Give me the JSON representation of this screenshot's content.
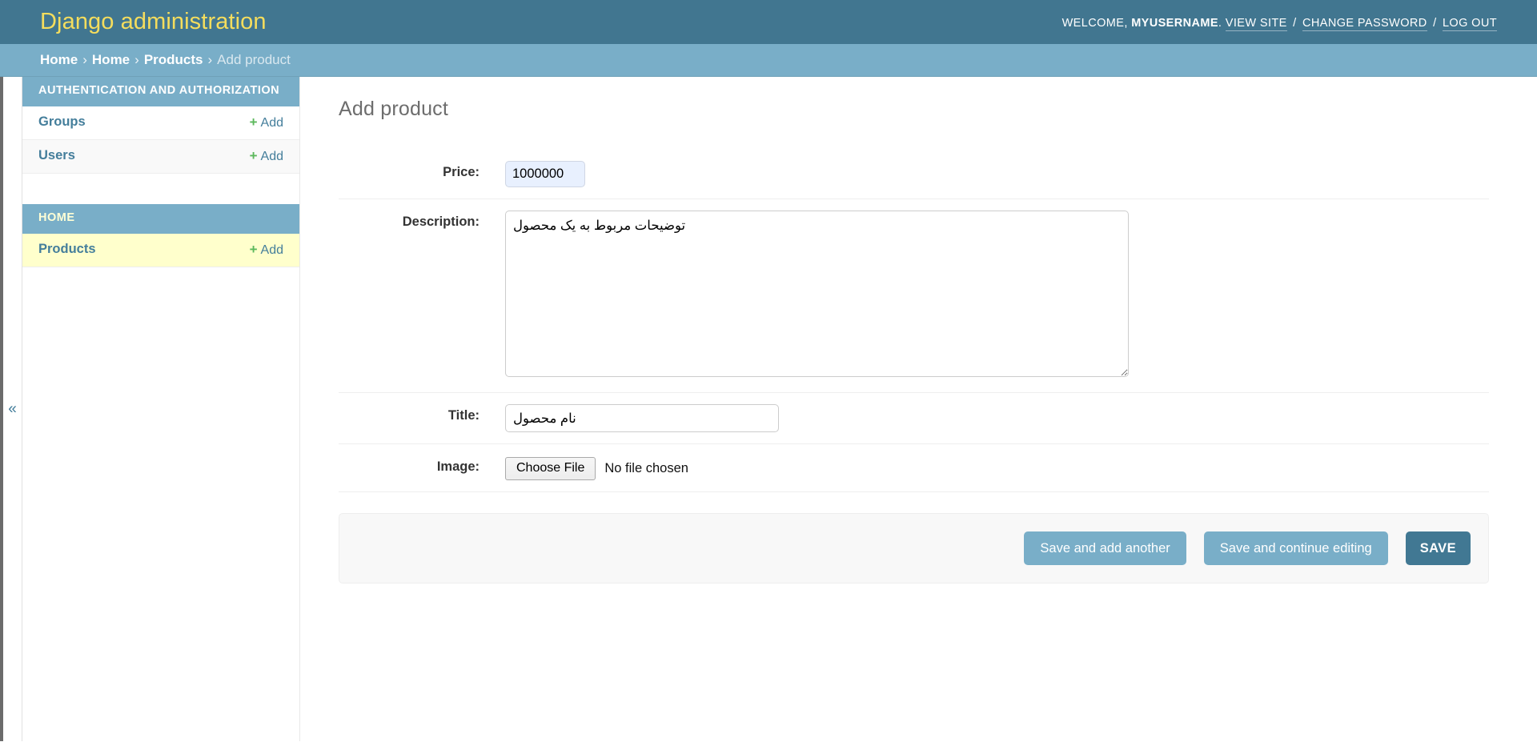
{
  "header": {
    "site_title": "Django administration",
    "welcome_prefix": "WELCOME,",
    "username": "MYUSERNAME",
    "username_suffix": ".",
    "view_site": "VIEW SITE",
    "change_password": "CHANGE PASSWORD",
    "log_out": "LOG OUT",
    "separator": "/"
  },
  "breadcrumbs": {
    "items": [
      {
        "label": "Home",
        "current": false
      },
      {
        "label": "Home",
        "current": false
      },
      {
        "label": "Products",
        "current": false
      },
      {
        "label": "Add product",
        "current": true
      }
    ],
    "separator": "›"
  },
  "sidebar": {
    "toggle_icon": "«",
    "apps": [
      {
        "caption": "AUTHENTICATION AND AUTHORIZATION",
        "models": [
          {
            "label": "Groups",
            "add_label": "Add",
            "add_icon": "+",
            "current": false
          },
          {
            "label": "Users",
            "add_label": "Add",
            "add_icon": "+",
            "current": false
          }
        ]
      },
      {
        "caption": "HOME",
        "models": [
          {
            "label": "Products",
            "add_label": "Add",
            "add_icon": "+",
            "current": true
          }
        ]
      }
    ]
  },
  "main": {
    "page_title": "Add product",
    "fields": [
      {
        "label": "Price:",
        "type": "number",
        "name": "price",
        "value": "1000000"
      },
      {
        "label": "Description:",
        "type": "textarea",
        "name": "description",
        "value": "توضیحات مربوط به یک محصول"
      },
      {
        "label": "Title:",
        "type": "text",
        "name": "title",
        "value": "نام محصول"
      },
      {
        "label": "Image:",
        "type": "file",
        "name": "image",
        "button_label": "Choose File",
        "status_text": "No file chosen"
      }
    ],
    "submit_row": {
      "save_and_add_another": "Save and add another",
      "save_and_continue": "Save and continue editing",
      "save": "SAVE"
    }
  },
  "colors": {
    "header_bg": "#417690",
    "header_title": "#f5dd5d",
    "breadcrumb_bg": "#79aec8",
    "link": "#447e9b",
    "button": "#79aec8",
    "button_default": "#417893",
    "add_plus": "#5cb85c",
    "current_model_bg": "#ffffcc",
    "autofill_bg": "#e8f0fe"
  }
}
